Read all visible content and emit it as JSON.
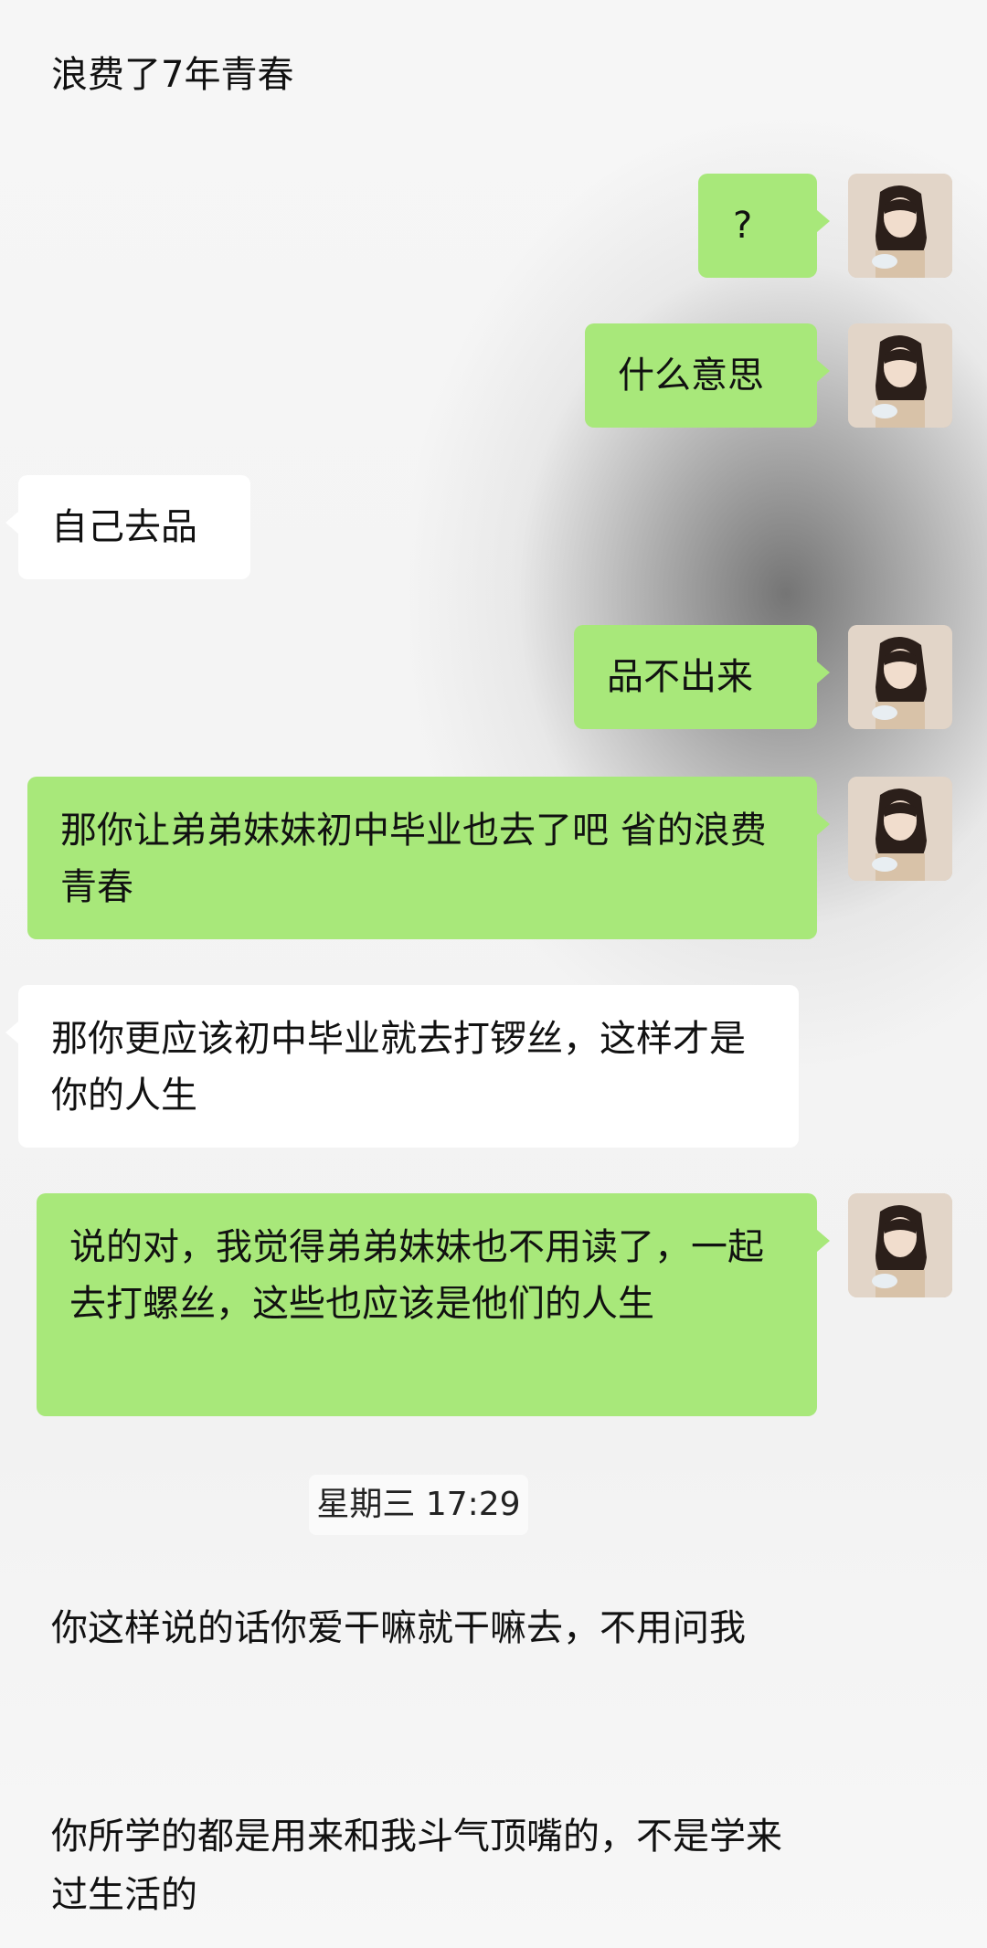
{
  "header_text": "浪费了7年青春",
  "messages": [
    {
      "side": "right",
      "text": "?"
    },
    {
      "side": "right",
      "text": "什么意思"
    },
    {
      "side": "left",
      "text": "自己去品"
    },
    {
      "side": "right",
      "text": "品不出来"
    },
    {
      "side": "right",
      "text": "那你让弟弟妹妹初中毕业也去了吧 省的浪费青春"
    },
    {
      "side": "left",
      "text": "那你更应该初中毕业就去打锣丝，这样才是你的人生"
    },
    {
      "side": "right",
      "text": "说的对，我觉得弟弟妹妹也不用读了，一起去打螺丝，这些也应该是他们的人生"
    }
  ],
  "timestamp": "星期三 17:29",
  "footer_texts": [
    "你这样说的话你爱干嘛就干嘛去，不用问我",
    "你所学的都是用来和我斗气顶嘴的，不是学来过生活的"
  ],
  "colors": {
    "sent_bubble": "#a8e87a",
    "received_bubble": "#ffffff"
  },
  "avatar_icon": "user-avatar-girl-reading-phone"
}
